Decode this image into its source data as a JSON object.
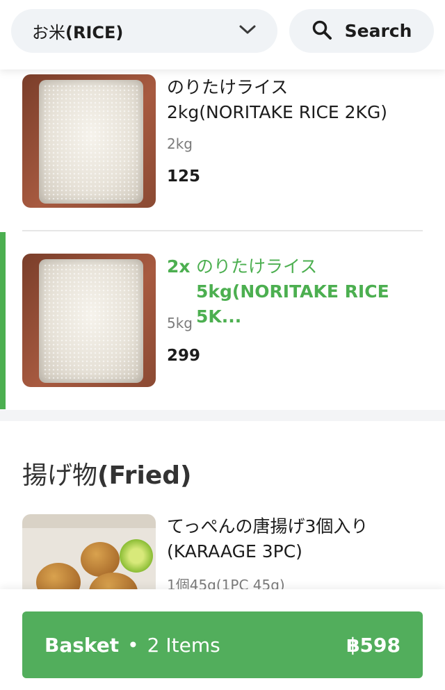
{
  "header": {
    "category_jp": "お米",
    "category_en": "(RICE)",
    "search_label": "Search"
  },
  "items": [
    {
      "name_line1": "のりたけライス",
      "name_line2": "2kg(NORITAKE RICE 2KG)",
      "unit": "2kg",
      "price": "125"
    },
    {
      "qty": "2x",
      "name_line1": "のりたけライス",
      "name_line2": "5kg(NORITAKE RICE 5K...",
      "unit": "5kg",
      "price": "299"
    }
  ],
  "section": {
    "title_jp": "揚げ物",
    "title_en": "(Fried)"
  },
  "fried_item": {
    "name_line1": "てっぺんの唐揚げ3個入り",
    "name_line2": "(KARAAGE 3PC)",
    "unit": "1個45g(1PC 45g)"
  },
  "basket": {
    "label": "Basket",
    "separator": "•",
    "count": "2 Items",
    "total": "฿598"
  },
  "colors": {
    "accent_green": "#4caf50",
    "basket_green": "#52ae5c"
  },
  "icons": {
    "dropdown": "chevron-down-icon",
    "search": "search-icon"
  }
}
